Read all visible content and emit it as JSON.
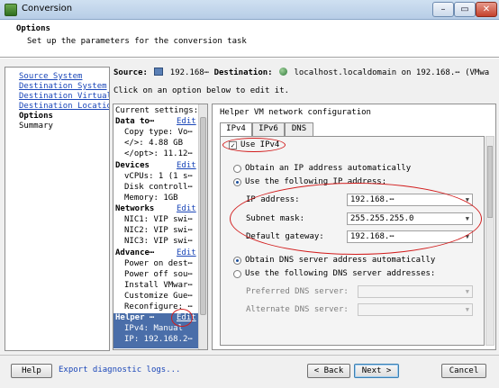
{
  "window": {
    "title": "Conversion",
    "min": "–",
    "max": "▭",
    "close": "✕"
  },
  "header": {
    "title": "Options",
    "subtitle": "Set up the parameters for the conversion task"
  },
  "nav": {
    "items": [
      {
        "label": "Source System",
        "state": "link"
      },
      {
        "label": "Destination System",
        "state": "link"
      },
      {
        "label": "Destination Virtual M",
        "state": "link"
      },
      {
        "label": "Destination Location",
        "state": "link"
      },
      {
        "label": "Options",
        "state": "current"
      },
      {
        "label": "Summary",
        "state": "plain"
      }
    ]
  },
  "summary_line": {
    "source_label": "Source:",
    "source_value": "192.168⋯",
    "destination_label": "Destination:",
    "destination_value": "localhost.localdomain on 192.168.⋯ (VMwa"
  },
  "click_hint": "Click on an option below to edit it.",
  "settings": {
    "header": "Current settings:",
    "edit_label": "Edit",
    "sections": [
      {
        "title": "Data to⋯",
        "items": [
          "Copy type: Vo⋯",
          "</>: 4.88 GB",
          "</opt>: 11.12⋯"
        ]
      },
      {
        "title": "Devices",
        "items": [
          "vCPUs: 1 (1 s⋯",
          "Disk controll⋯",
          "Memory: 1GB"
        ]
      },
      {
        "title": "Networks",
        "items": [
          "NIC1: VIP swi⋯",
          "NIC2: VIP swi⋯",
          "NIC3: VIP swi⋯"
        ]
      },
      {
        "title": "Advance⋯",
        "items": [
          "Power on dest⋯",
          "Power off sou⋯",
          "Install VMwar⋯",
          "Customize Gue⋯",
          "Reconfigure: ⋯"
        ]
      },
      {
        "title": "Helper ⋯",
        "items": [
          "IPv4: Manual",
          "IP: 192.168.2⋯"
        ]
      }
    ]
  },
  "helper_panel": {
    "title": "Helper VM network configuration",
    "tabs": [
      "IPv4",
      "IPv6",
      "DNS"
    ],
    "use_ipv4_label": "Use IPv4",
    "ip_auto_label": "Obtain an IP address automatically",
    "ip_manual_label": "Use the following IP address:",
    "ip_address_label": "IP address:",
    "ip_address_value": "192.168.⋯",
    "subnet_label": "Subnet mask:",
    "subnet_value": "255.255.255.0",
    "gateway_label": "Default gateway:",
    "gateway_value": "192.168.⋯",
    "dns_auto_label": "Obtain DNS server address automatically",
    "dns_manual_label": "Use the following DNS server addresses:",
    "preferred_dns_label": "Preferred DNS server:",
    "alternate_dns_label": "Alternate DNS server:",
    "ipv4_checked": true,
    "ip_mode": "manual",
    "dns_mode": "auto"
  },
  "footer": {
    "help": "Help",
    "export_logs": "Export diagnostic logs...",
    "back": "< Back",
    "next": "Next >",
    "cancel": "Cancel"
  },
  "colors": {
    "accent": "#4a6ea9",
    "link": "#1a46b8",
    "annotation": "#d21d1d"
  }
}
